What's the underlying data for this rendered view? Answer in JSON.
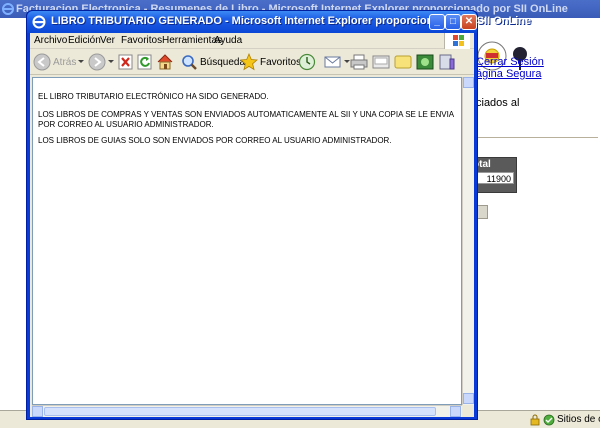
{
  "background_window": {
    "title": "Facturacion Electronica - Resumenes de Libro - Microsoft Internet Explorer proporcionado por SII OnLine",
    "links": {
      "close_session": "Cerrar Sesión",
      "secure_page": "ágina Segura"
    },
    "partial_text": "ciados al",
    "table": {
      "header": "otal",
      "value": "11900"
    },
    "status": {
      "zone_text": "Sitios de confi"
    }
  },
  "popup": {
    "title": "LIBRO TRIBUTARIO GENERADO - Microsoft Internet Explorer proporcionado por SII OnLine",
    "menu": [
      "Archivo",
      "Edición",
      "Ver",
      "Favoritos",
      "Herramientas",
      "Ayuda"
    ],
    "toolbar": {
      "back_label": "Atrás",
      "search_label": "Búsqueda",
      "favorites_label": "Favoritos"
    },
    "content": {
      "line1": "EL LIBRO TRIBUTARIO ELECTRÓNICO HA SIDO GENERADO.",
      "line2": "LOS LIBROS DE COMPRAS Y VENTAS SON ENVIADOS AUTOMATICAMENTE AL SII Y UNA COPIA SE LE ENVIA POR CORREO AL USUARIO ADMINISTRADOR.",
      "line3": "LOS LIBROS DE GUIAS SOLO SON ENVIADOS POR CORREO AL USUARIO ADMINISTRADOR."
    }
  },
  "colors": {
    "titlebar_blue": "#0a46d6",
    "link_blue": "#0000cc",
    "chrome": "#ece9d8"
  }
}
